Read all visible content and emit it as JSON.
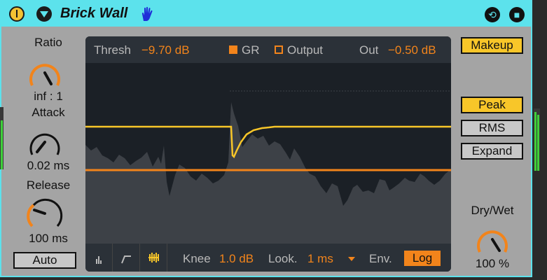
{
  "device": {
    "title": "Brick Wall",
    "accent": "#5ce2ec",
    "power_icon": "power-icon",
    "fold_icon": "fold-icon",
    "hand_icon": "hand-icon",
    "hot_swap_icon": "hot-swap-icon",
    "save_icon": "save-preset-icon"
  },
  "knobs": {
    "ratio": {
      "label": "Ratio",
      "value": "inf : 1"
    },
    "attack": {
      "label": "Attack",
      "value": "0.02 ms"
    },
    "release": {
      "label": "Release",
      "value": "100 ms"
    },
    "drywet": {
      "label": "Dry/Wet",
      "value": "100 %"
    }
  },
  "auto_button": {
    "label": "Auto"
  },
  "display": {
    "thresh_label": "Thresh",
    "thresh_value": "−9.70 dB",
    "gr_label": "GR",
    "output_label": "Output",
    "out_label": "Out",
    "out_value": "−0.50 dB",
    "knee_label": "Knee",
    "knee_value": "1.0 dB",
    "look_label": "Look.",
    "look_value": "1 ms",
    "env_label": "Env.",
    "env_value": "Log",
    "orange": "#f2841b",
    "gold": "#f8c629"
  },
  "side_buttons": {
    "makeup": "Makeup",
    "peak": "Peak",
    "rms": "RMS",
    "expand": "Expand"
  }
}
